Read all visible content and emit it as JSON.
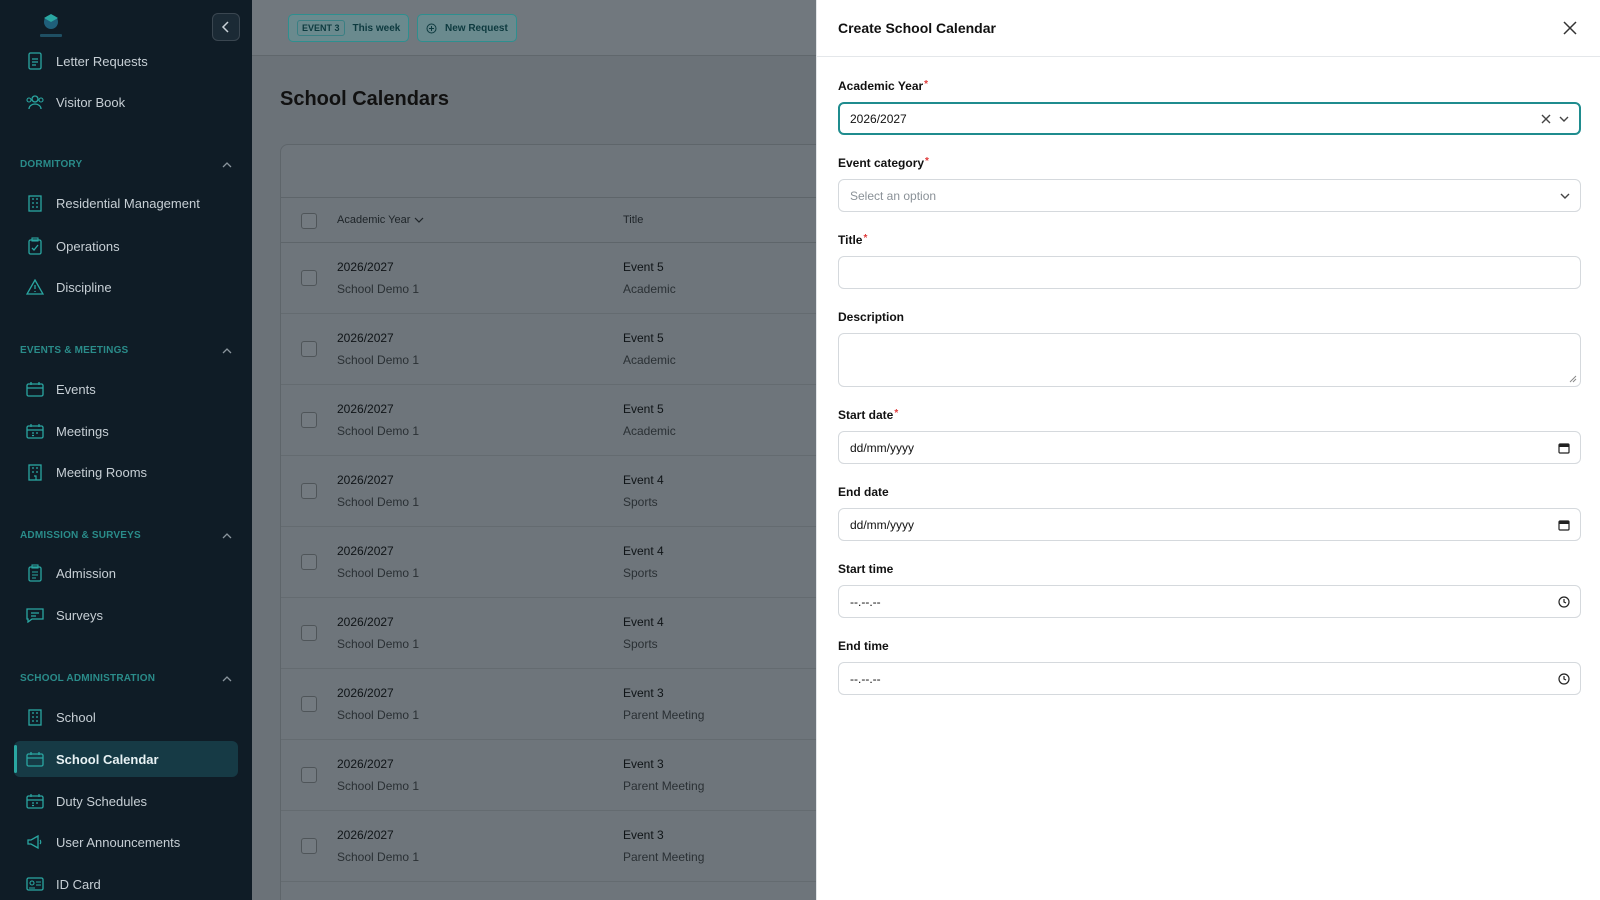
{
  "sidebar": {
    "items": [
      {
        "label": "Letter Requests",
        "icon": "document-icon"
      },
      {
        "label": "Visitor Book",
        "icon": "users-icon"
      },
      {
        "label": "Residential Management",
        "icon": "building-icon"
      },
      {
        "label": "Operations",
        "icon": "clipboard-check-icon"
      },
      {
        "label": "Discipline",
        "icon": "warning-icon"
      },
      {
        "label": "Events",
        "icon": "calendar-icon"
      },
      {
        "label": "Meetings",
        "icon": "calendar-grid-icon"
      },
      {
        "label": "Meeting Rooms",
        "icon": "building-icon"
      },
      {
        "label": "Admission",
        "icon": "clipboard-icon"
      },
      {
        "label": "Surveys",
        "icon": "chat-icon"
      },
      {
        "label": "School",
        "icon": "building-icon"
      },
      {
        "label": "School Calendar",
        "icon": "calendar-icon"
      },
      {
        "label": "Duty Schedules",
        "icon": "calendar-grid-icon"
      },
      {
        "label": "User Announcements",
        "icon": "megaphone-icon"
      },
      {
        "label": "ID Card",
        "icon": "id-card-icon"
      }
    ],
    "sections": {
      "dormitory": "DORMITORY",
      "events": "EVENTS & MEETINGS",
      "admission": "ADMISSION & SURVEYS",
      "school_admin": "SCHOOL ADMINISTRATION"
    }
  },
  "topbar": {
    "event_tag": "EVENT 3",
    "event_when": "This week",
    "new_request": "New Request"
  },
  "main": {
    "title": "School Calendars",
    "columns": {
      "academic_year": "Academic Year",
      "title": "Title"
    },
    "rows": [
      {
        "year": "2026/2027",
        "school": "School Demo 1",
        "title": "Event 5",
        "category": "Academic"
      },
      {
        "year": "2026/2027",
        "school": "School Demo 1",
        "title": "Event 5",
        "category": "Academic"
      },
      {
        "year": "2026/2027",
        "school": "School Demo 1",
        "title": "Event 5",
        "category": "Academic"
      },
      {
        "year": "2026/2027",
        "school": "School Demo 1",
        "title": "Event 4",
        "category": "Sports"
      },
      {
        "year": "2026/2027",
        "school": "School Demo 1",
        "title": "Event 4",
        "category": "Sports"
      },
      {
        "year": "2026/2027",
        "school": "School Demo 1",
        "title": "Event 4",
        "category": "Sports"
      },
      {
        "year": "2026/2027",
        "school": "School Demo 1",
        "title": "Event 3",
        "category": "Parent Meeting"
      },
      {
        "year": "2026/2027",
        "school": "School Demo 1",
        "title": "Event 3",
        "category": "Parent Meeting"
      },
      {
        "year": "2026/2027",
        "school": "School Demo 1",
        "title": "Event 3",
        "category": "Parent Meeting"
      }
    ]
  },
  "drawer": {
    "title": "Create School Calendar",
    "academic_year": {
      "label": "Academic Year",
      "value": "2026/2027"
    },
    "event_category": {
      "label": "Event category",
      "placeholder": "Select an option"
    },
    "title_field": {
      "label": "Title",
      "value": ""
    },
    "description": {
      "label": "Description",
      "value": ""
    },
    "start_date": {
      "label": "Start date",
      "value": "dd/mm/yyyy"
    },
    "end_date": {
      "label": "End date",
      "value": "dd/mm/yyyy"
    },
    "start_time": {
      "label": "Start time",
      "value": "--.--.--"
    },
    "end_time": {
      "label": "End time",
      "value": "--.--.--"
    },
    "required_mark": "*"
  },
  "colors": {
    "accent": "#1f8c8e",
    "sidebar_bg": "#0f1c26",
    "required": "#e03b3b"
  }
}
